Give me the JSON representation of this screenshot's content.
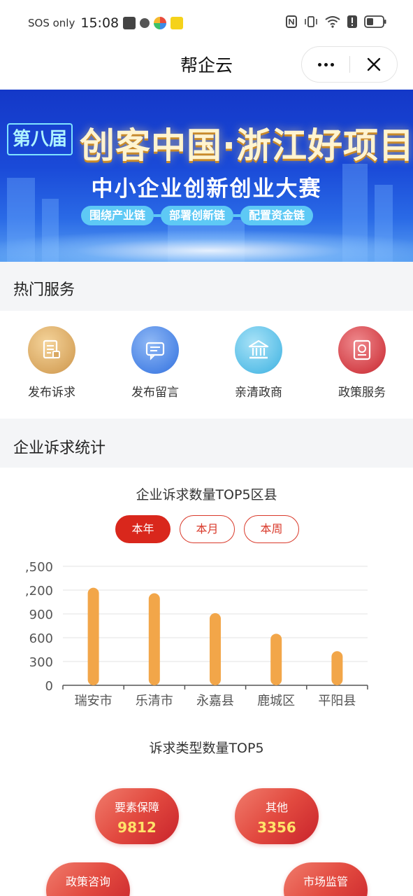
{
  "status_bar": {
    "carrier": "SOS only",
    "time": "15:08"
  },
  "nav": {
    "title": "帮企云"
  },
  "banner": {
    "edition": "第八届",
    "title": "创客中国·浙江好项目",
    "subtitle": "中小企业创新创业大赛",
    "tags": [
      "围绕产业链",
      "部署创新链",
      "配置资金链"
    ]
  },
  "hot_services": {
    "heading": "热门服务",
    "items": [
      {
        "label": "发布诉求",
        "icon": "document-icon",
        "color": "#d9a862"
      },
      {
        "label": "发布留言",
        "icon": "message-icon",
        "color": "#4d86e6"
      },
      {
        "label": "亲清政商",
        "icon": "government-building-icon",
        "color": "#5cc0e8"
      },
      {
        "label": "政策服务",
        "icon": "policy-certificate-icon",
        "color": "#d4434a"
      }
    ]
  },
  "stats": {
    "heading": "企业诉求统计",
    "chart_title": "企业诉求数量TOP5区县",
    "periods": [
      "本年",
      "本月",
      "本周"
    ],
    "active_period": "本年",
    "types_title": "诉求类型数量TOP5",
    "types": [
      {
        "name": "要素保障",
        "value": "9812"
      },
      {
        "name": "其他",
        "value": "3356"
      },
      {
        "name": "政策咨询",
        "value": ""
      },
      {
        "name": "市场监管",
        "value": ""
      }
    ]
  },
  "chart_data": {
    "type": "bar",
    "categories": [
      "瑞安市",
      "乐清市",
      "永嘉县",
      "鹿城区",
      "平阳县"
    ],
    "values": [
      1230,
      1160,
      910,
      650,
      430
    ],
    "ytick_labels": [
      ",500",
      ",200",
      "900",
      "600",
      "300",
      "0"
    ],
    "ylim": [
      0,
      1500
    ],
    "grid": true,
    "bar_color": "#f2a649",
    "xlabel": "",
    "ylabel": "",
    "title": ""
  }
}
